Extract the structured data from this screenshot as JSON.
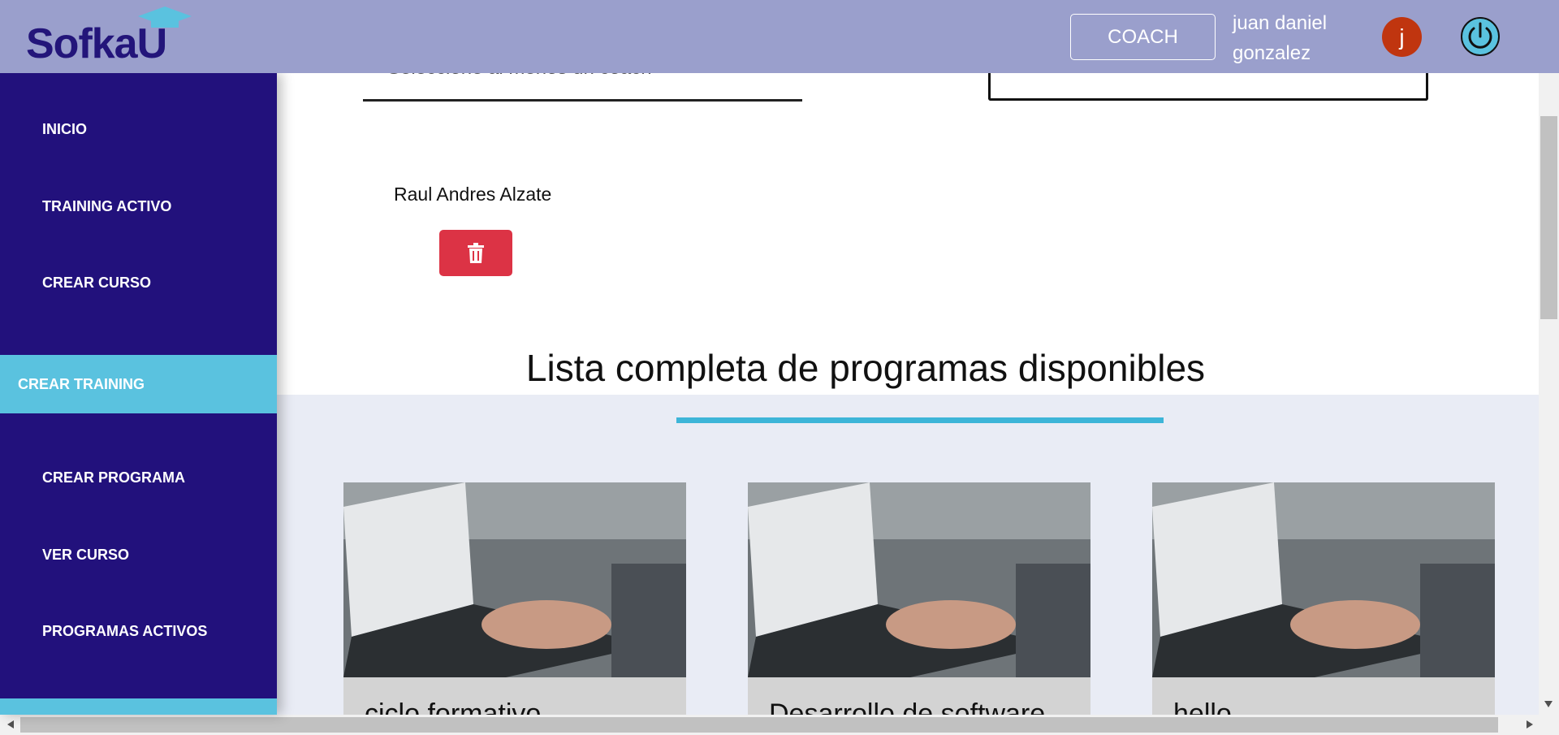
{
  "header": {
    "logo_text": "SofkaU",
    "role_button": "COACH",
    "user_name_line1": "juan daniel",
    "user_name_line2": "gonzalez",
    "avatar_letter": "j"
  },
  "sidebar": {
    "items": [
      {
        "label": "INICIO"
      },
      {
        "label": "TRAINING ACTIVO"
      },
      {
        "label": "CREAR CURSO"
      },
      {
        "label": "CREAR TRAINING",
        "active": true
      },
      {
        "label": "CREAR PROGRAMA"
      },
      {
        "label": "VER CURSO"
      },
      {
        "label": "PROGRAMAS ACTIVOS"
      }
    ]
  },
  "form": {
    "coach_select_placeholder": "Seleccione al menos un coach",
    "selected_coach": "Raul Andres Alzate"
  },
  "programs": {
    "title": "Lista completa de programas disponibles",
    "cards": [
      {
        "title": "ciclo formativo"
      },
      {
        "title": "Desarrollo de software"
      },
      {
        "title": "hello"
      }
    ]
  },
  "colors": {
    "header_bg": "#9a9fcc",
    "sidebar_bg": "#22117c",
    "active_item_bg": "#5ac2df",
    "delete_button": "#dc3345",
    "accent_underline": "#3db5d8"
  }
}
